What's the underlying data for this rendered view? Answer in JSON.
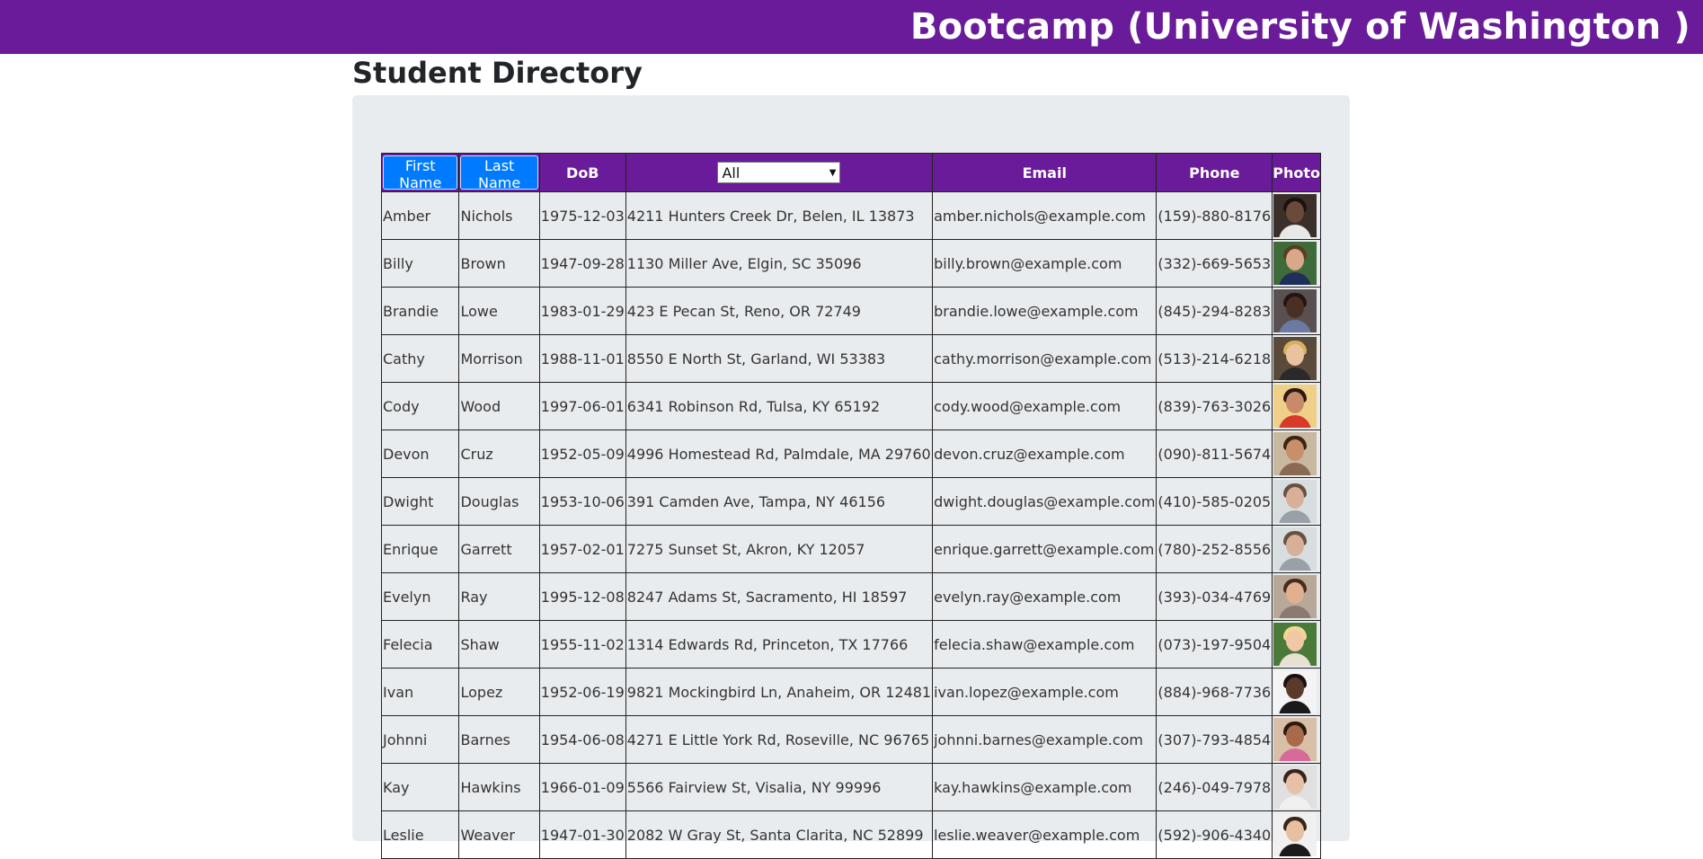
{
  "app": {
    "title": "Bootcamp (University of Washington )"
  },
  "page": {
    "title": "Student Directory"
  },
  "table": {
    "headers": {
      "first_name": "First Name",
      "last_name": "Last Name",
      "dob": "DoB",
      "filter_selected": "All",
      "email": "Email",
      "phone": "Phone",
      "photo": "Photo"
    },
    "rows": [
      {
        "first": "Amber",
        "last": "Nichols",
        "dob": "1975-12-03",
        "address": "4211 Hunters Creek Dr, Belen, IL 13873",
        "email": "amber.nichols@example.com",
        "phone": "(159)-880-8176",
        "photo": {
          "bg": "#3b2f2a",
          "skin": "#6b4a3a",
          "hair": "#1a1210",
          "shirt": "#e8e8e8"
        }
      },
      {
        "first": "Billy",
        "last": "Brown",
        "dob": "1947-09-28",
        "address": "1130 Miller Ave, Elgin, SC 35096",
        "email": "billy.brown@example.com",
        "phone": "(332)-669-5653",
        "photo": {
          "bg": "#3f6b3a",
          "skin": "#d9a88a",
          "hair": "#5a3b25",
          "shirt": "#1f2f5a"
        }
      },
      {
        "first": "Brandie",
        "last": "Lowe",
        "dob": "1983-01-29",
        "address": "423 E Pecan St, Reno, OR 72749",
        "email": "brandie.lowe@example.com",
        "phone": "(845)-294-8283",
        "photo": {
          "bg": "#5a5050",
          "skin": "#4a3024",
          "hair": "#221410",
          "shirt": "#6a7aa0"
        }
      },
      {
        "first": "Cathy",
        "last": "Morrison",
        "dob": "1988-11-01",
        "address": "8550 E North St, Garland, WI 53383",
        "email": "cathy.morrison@example.com",
        "phone": "(513)-214-6218",
        "photo": {
          "bg": "#5a4a3a",
          "skin": "#e9c3a0",
          "hair": "#d9b060",
          "shirt": "#2a2a2a"
        }
      },
      {
        "first": "Cody",
        "last": "Wood",
        "dob": "1997-06-01",
        "address": "6341 Robinson Rd, Tulsa, KY 65192",
        "email": "cody.wood@example.com",
        "phone": "(839)-763-3026",
        "photo": {
          "bg": "#f0d088",
          "skin": "#c88a6a",
          "hair": "#2a1a12",
          "shirt": "#d83a2a"
        }
      },
      {
        "first": "Devon",
        "last": "Cruz",
        "dob": "1952-05-09",
        "address": "4996 Homestead Rd, Palmdale, MA 29760",
        "email": "devon.cruz@example.com",
        "phone": "(090)-811-5674",
        "photo": {
          "bg": "#c8b8a0",
          "skin": "#c8906a",
          "hair": "#3a2414",
          "shirt": "#8a6a50"
        }
      },
      {
        "first": "Dwight",
        "last": "Douglas",
        "dob": "1953-10-06",
        "address": "391 Camden Ave, Tampa, NY 46156",
        "email": "dwight.douglas@example.com",
        "phone": "(410)-585-0205",
        "photo": {
          "bg": "#d8dde0",
          "skin": "#d8b09a",
          "hair": "#6a5040",
          "shirt": "#9aa0a8"
        }
      },
      {
        "first": "Enrique",
        "last": "Garrett",
        "dob": "1957-02-01",
        "address": "7275 Sunset St, Akron, KY 12057",
        "email": "enrique.garrett@example.com",
        "phone": "(780)-252-8556",
        "photo": {
          "bg": "#d8dde0",
          "skin": "#d8b09a",
          "hair": "#6a5040",
          "shirt": "#9aa0a8"
        }
      },
      {
        "first": "Evelyn",
        "last": "Ray",
        "dob": "1995-12-08",
        "address": "8247 Adams St, Sacramento, HI 18597",
        "email": "evelyn.ray@example.com",
        "phone": "(393)-034-4769",
        "photo": {
          "bg": "#b8a898",
          "skin": "#e0b090",
          "hair": "#4a2a1a",
          "shirt": "#8a7a70"
        }
      },
      {
        "first": "Felecia",
        "last": "Shaw",
        "dob": "1955-11-02",
        "address": "1314 Edwards Rd, Princeton, TX 17766",
        "email": "felecia.shaw@example.com",
        "phone": "(073)-197-9504",
        "photo": {
          "bg": "#4a7a3a",
          "skin": "#f0c8a8",
          "hair": "#f0d890",
          "shirt": "#e8e0d0"
        }
      },
      {
        "first": "Ivan",
        "last": "Lopez",
        "dob": "1952-06-19",
        "address": "9821 Mockingbird Ln, Anaheim, OR 12481",
        "email": "ivan.lopez@example.com",
        "phone": "(884)-968-7736",
        "photo": {
          "bg": "#f4f4f4",
          "skin": "#5a3a2a",
          "hair": "#1a1010",
          "shirt": "#1a1a1a"
        }
      },
      {
        "first": "Johnni",
        "last": "Barnes",
        "dob": "1954-06-08",
        "address": "4271 E Little York Rd, Roseville, NC 96765",
        "email": "johnni.barnes@example.com",
        "phone": "(307)-793-4854",
        "photo": {
          "bg": "#d8c0a8",
          "skin": "#a86a4a",
          "hair": "#2a1a12",
          "shirt": "#d86a9a"
        }
      },
      {
        "first": "Kay",
        "last": "Hawkins",
        "dob": "1966-01-09",
        "address": "5566 Fairview St, Visalia, NY 99996",
        "email": "kay.hawkins@example.com",
        "phone": "(246)-049-7978",
        "photo": {
          "bg": "#e0e0e0",
          "skin": "#e8c0a8",
          "hair": "#3a2218",
          "shirt": "#f0f0f0"
        }
      },
      {
        "first": "Leslie",
        "last": "Weaver",
        "dob": "1947-01-30",
        "address": "2082 W Gray St, Santa Clarita, NC 52899",
        "email": "leslie.weaver@example.com",
        "phone": "(592)-906-4340",
        "photo": {
          "bg": "#f0f0f0",
          "skin": "#e8c0a0",
          "hair": "#3a2418",
          "shirt": "#1a1a1a"
        }
      }
    ]
  }
}
